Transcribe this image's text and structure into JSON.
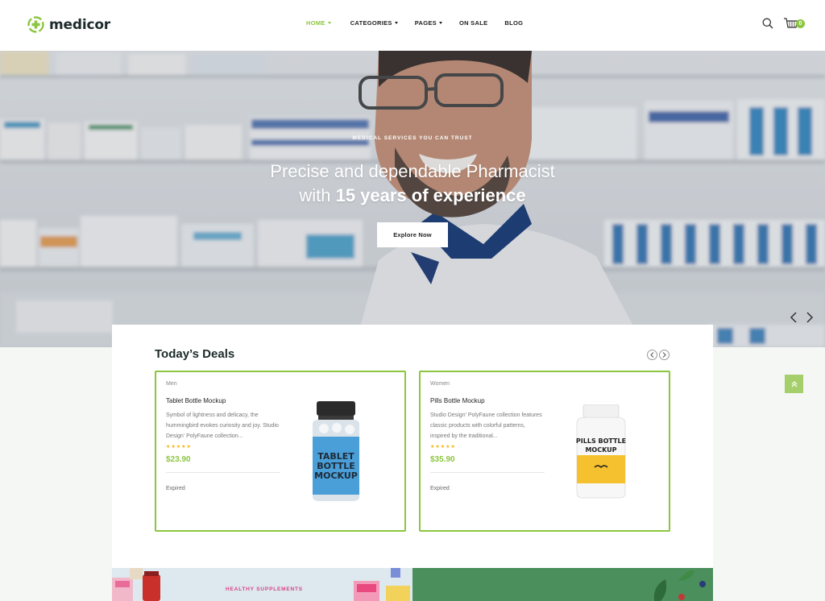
{
  "brand": {
    "name": "medicor",
    "accent": "#8cc63f"
  },
  "nav": {
    "items": [
      {
        "label": "HOME",
        "has_caret": true,
        "active": true
      },
      {
        "label": "CATEGORIES",
        "has_caret": true,
        "active": false
      },
      {
        "label": "PAGES",
        "has_caret": true,
        "active": false
      },
      {
        "label": "ON SALE",
        "has_caret": false,
        "active": false
      },
      {
        "label": "BLOG",
        "has_caret": false,
        "active": false
      }
    ]
  },
  "header": {
    "icons": [
      "search-icon",
      "cart-icon"
    ],
    "cart_count": "0"
  },
  "hero": {
    "tagline": "MEDICAL SERVICES YOU CAN TRUST",
    "title_line1": "Precise and dependable Pharmacist",
    "title_line2_prefix": "with ",
    "title_line2_bold": "15 years of experience",
    "cta_label": "Explore Now"
  },
  "deals": {
    "title": "Today’s Deals",
    "products": [
      {
        "category": "Men",
        "name": "Tablet Bottle Mockup",
        "description": "Symbol of lightness and delicacy, the hummingbird evokes curiosity and joy. Studio Design' PolyFaune collection...",
        "stars": "★★★★★",
        "price": "$23.90",
        "status": "Expired",
        "label_lines": [
          "TABLET",
          "BOTTLE",
          "MOCKUP"
        ],
        "label_color": "#4a9fd8"
      },
      {
        "category": "Women",
        "name": "Pills Bottle Mockup",
        "description": "Studio Design' PolyFaune collection features classic products with colorful patterns, inspired by the traditional...",
        "stars": "★★★★★",
        "price": "$35.90",
        "status": "Expired",
        "label_lines": [
          "PILLS BOTTLE",
          "MOCKUP"
        ],
        "label_color": "#f6c12e"
      }
    ]
  },
  "banners": {
    "left_label": "HEALTHY SUPPLEMENTS"
  }
}
